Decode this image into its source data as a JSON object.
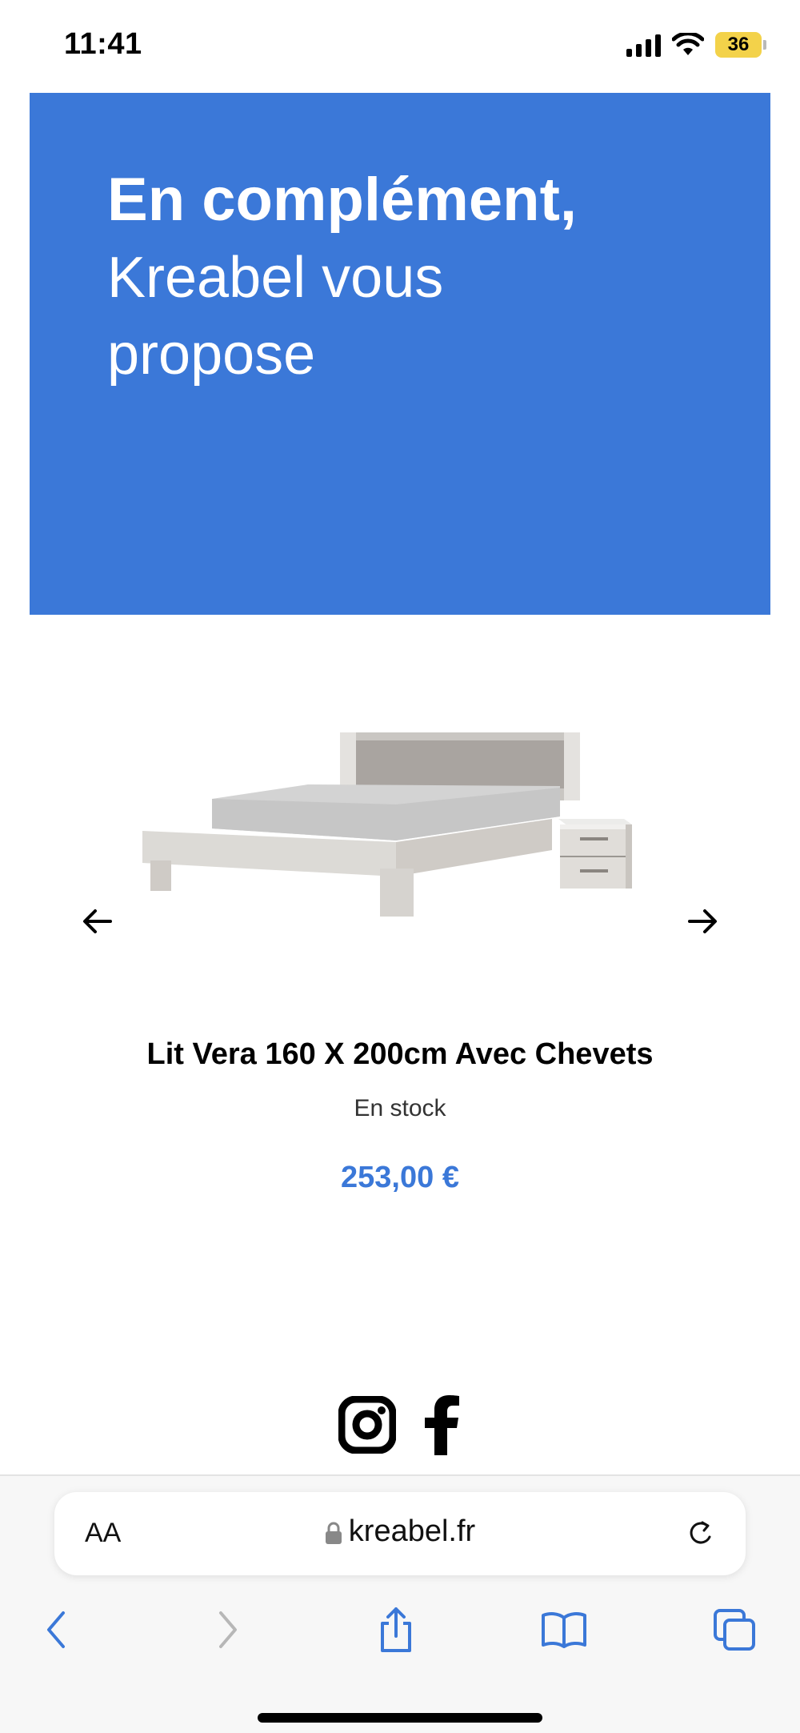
{
  "status_bar": {
    "time": "11:41",
    "battery_level": "36"
  },
  "banner": {
    "bold_line": "En complément,",
    "line_1": "Kreabel vous",
    "line_2": "propose",
    "background_color": "#3b78d8"
  },
  "product": {
    "title": "Lit Vera 160 X 200cm Avec Chevets",
    "stock": "En stock",
    "price": "253,00 €",
    "price_color": "#3b78d8",
    "image_icon": "bed-with-nightstand"
  },
  "social": {
    "icons": [
      "instagram-icon",
      "facebook-icon"
    ]
  },
  "browser": {
    "text_size_label": "AA",
    "url": "kreabel.fr",
    "nav_icons": [
      "back-icon",
      "forward-icon",
      "share-icon",
      "bookmarks-icon",
      "tabs-icon"
    ]
  }
}
